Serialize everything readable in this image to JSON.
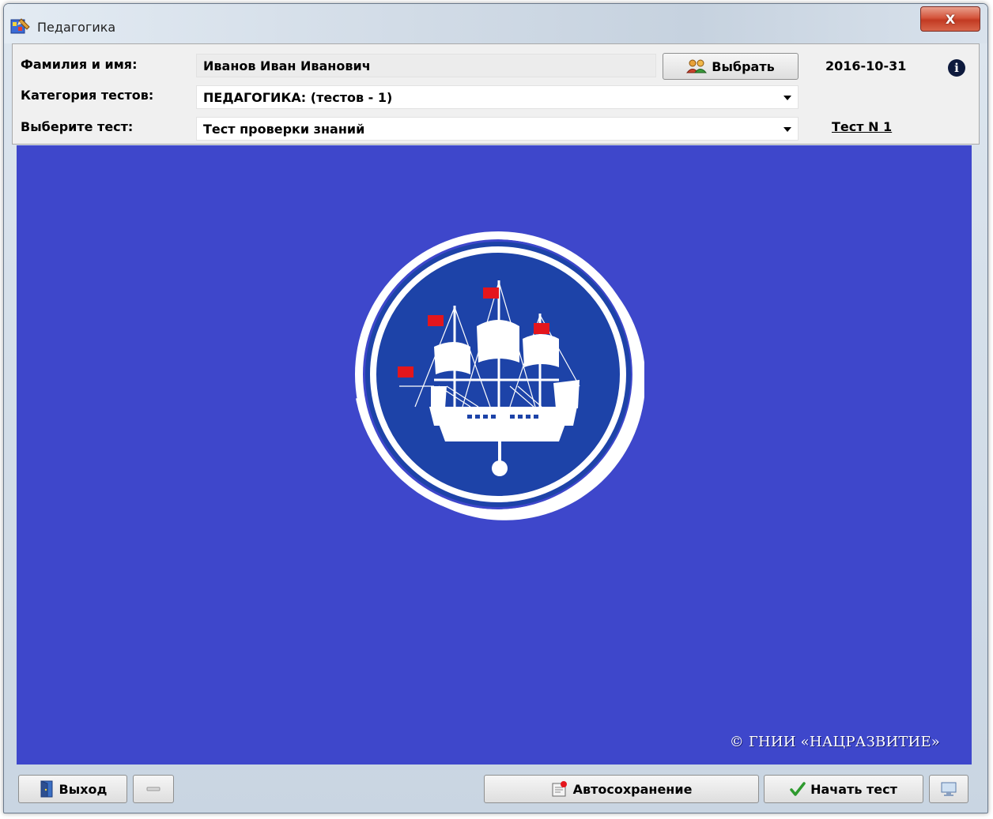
{
  "window": {
    "title": "Педагогика",
    "close_label": "X"
  },
  "form": {
    "name_label": "Фамилия и имя:",
    "name_value": "Иванов Иван Иванович",
    "select_button_label": "Выбрать",
    "date": "2016-10-31",
    "category_label": "Категория тестов:",
    "category_value": "ПЕДАГОГИКА: (тестов - 1)",
    "test_label": "Выберите тест:",
    "test_value": "Тест проверки знаний",
    "test_number_link": "Тест N 1"
  },
  "content": {
    "background_color": "#3e47cb",
    "logo_icon": "sailing-ship-emblem",
    "copyright": "© ГНИИ «НАЦРАЗВИТИЕ»"
  },
  "footer": {
    "exit_label": "Выход",
    "autosave_label": "Автосохранение",
    "start_label": "Начать тест"
  }
}
